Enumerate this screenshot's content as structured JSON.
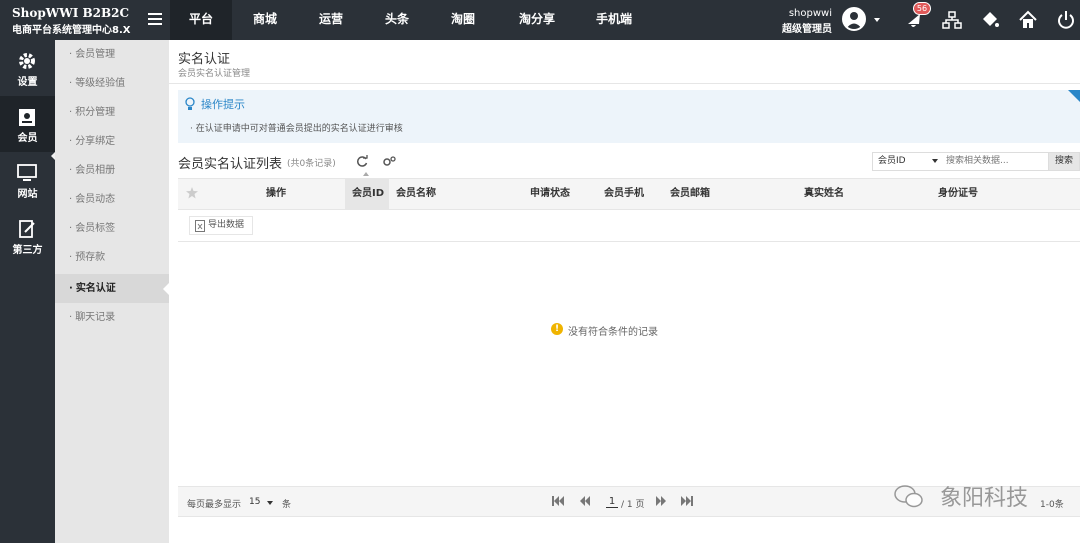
{
  "brand": {
    "title": "ShopWWI B2B2C",
    "subtitle": "电商平台系统管理中心8.X"
  },
  "topnav": [
    "平台",
    "商城",
    "运营",
    "头条",
    "淘圈",
    "淘分享",
    "手机端"
  ],
  "user": {
    "name": "shopwwi",
    "role": "超级管理员"
  },
  "notifications": {
    "count": "56"
  },
  "top_icons": [
    "bell-icon",
    "sitemap-icon",
    "paint-bucket-icon",
    "home-icon",
    "power-icon"
  ],
  "iconbar": [
    {
      "label": "设置",
      "icon": "gear-icon"
    },
    {
      "label": "会员",
      "icon": "member-icon"
    },
    {
      "label": "网站",
      "icon": "website-icon"
    },
    {
      "label": "第三方",
      "icon": "third-party-icon"
    }
  ],
  "subbar": [
    "会员管理",
    "等级经验值",
    "积分管理",
    "分享绑定",
    "会员相册",
    "会员动态",
    "会员标签",
    "预存款",
    "实名认证",
    "聊天记录"
  ],
  "page": {
    "title": "实名认证",
    "subtitle": "会员实名认证管理"
  },
  "tips": {
    "title": "操作提示",
    "text": "在认证申请中可对普通会员提出的实名认证进行审核"
  },
  "list": {
    "title": "会员实名认证列表",
    "count": "(共0条记录)"
  },
  "search": {
    "field": "会员ID",
    "placeholder": "搜索相关数据...",
    "button": "搜索"
  },
  "table": {
    "columns": [
      "操作",
      "会员ID",
      "会员名称",
      "申请状态",
      "会员手机",
      "会员邮箱",
      "真实姓名",
      "身份证号"
    ],
    "sorted_column": "会员ID",
    "export_label": "导出数据",
    "empty_message": "没有符合条件的记录"
  },
  "pager": {
    "size_label": "每页最多显示",
    "size": "15",
    "unit": "条",
    "current": "1",
    "total": "/ 1 页",
    "range": "1-0条"
  },
  "watermark": "象阳科技",
  "colors": {
    "topbar": "#2b3138",
    "accent": "#2a86c8",
    "badge": "#e05a5a",
    "warning": "#f0b400"
  }
}
